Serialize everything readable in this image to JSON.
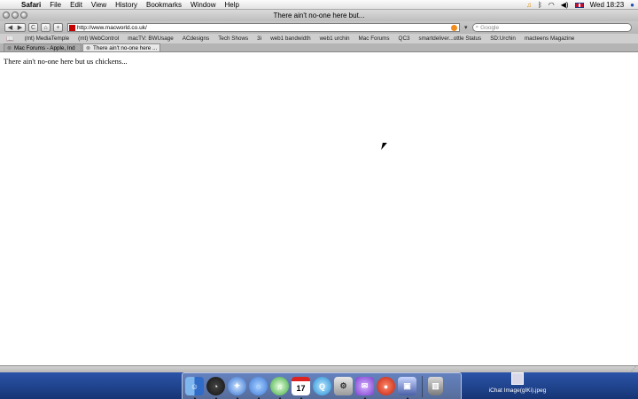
{
  "menubar": {
    "apple": "",
    "items": [
      "Safari",
      "File",
      "Edit",
      "View",
      "History",
      "Bookmarks",
      "Window",
      "Help"
    ],
    "clock": "Wed 18:23"
  },
  "window": {
    "title": "There ain't no-one here but..."
  },
  "toolbar": {
    "back": "◀",
    "forward": "▶",
    "reload": "C",
    "home": "⌂",
    "add": "+",
    "url": "http://www.macworld.co.uk/",
    "search_placeholder": "Google"
  },
  "bookmarks": [
    "(mt) MediaTemple",
    "(mt) WebControl",
    "macTV: BWUsage",
    "ACdesigns",
    "Tech Shows",
    "3i",
    "web1 bandwidth",
    "web1 urchin",
    "Mac Forums",
    "QC3",
    "smartdeliver...ottle Status",
    "SD:Urchin",
    "macteens Magazine"
  ],
  "tabs": [
    {
      "label": "Mac Forums - Apple, Ind"
    },
    {
      "label": "There ain't no-one here ..."
    }
  ],
  "page": {
    "text": "There ain't no-one here but us chickens..."
  },
  "dock": {
    "icons": [
      "finder",
      "dashboard",
      "safari",
      "ichat",
      "itunes",
      "ical",
      "quicktime",
      "system-preferences",
      "mail-app",
      "tomato-app",
      "preview",
      "trash"
    ],
    "ical_day": "17"
  },
  "desktop": {
    "file_label": "iChat Image(gIKi).jpeg"
  }
}
